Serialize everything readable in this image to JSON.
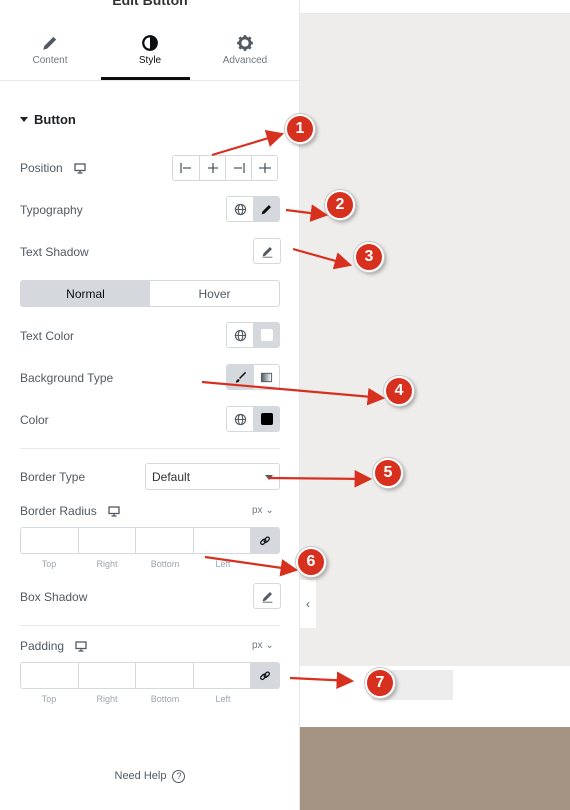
{
  "panel": {
    "title": "Edit Button",
    "tabs": [
      {
        "label": "Content",
        "icon": "pencil-icon"
      },
      {
        "label": "Style",
        "icon": "half-circle-icon"
      },
      {
        "label": "Advanced",
        "icon": "gear-icon"
      }
    ],
    "active_tab": "Style"
  },
  "section": {
    "title": "Button"
  },
  "rows": {
    "position": "Position",
    "typography": "Typography",
    "text_shadow": "Text Shadow",
    "text_color": "Text Color",
    "background_type": "Background Type",
    "color": "Color",
    "border_type": "Border Type",
    "border_radius": "Border Radius",
    "box_shadow": "Box Shadow",
    "padding": "Padding"
  },
  "state_tabs": {
    "normal": "Normal",
    "hover": "Hover",
    "active": "Normal"
  },
  "border_type_select": {
    "value": "Default"
  },
  "units": {
    "border_radius": "px",
    "padding": "px"
  },
  "dimension_labels": [
    "Top",
    "Right",
    "Bottom",
    "Left"
  ],
  "footer": {
    "need_help": "Need Help",
    "help_icon": "?"
  },
  "annotations": [
    "1",
    "2",
    "3",
    "4",
    "5",
    "6",
    "7"
  ],
  "colors": {
    "accent_dark": "#0c0d0e",
    "annotation_red": "#d7301f",
    "preview_bg": "#eeedeb",
    "preview_brown": "#a59483"
  }
}
